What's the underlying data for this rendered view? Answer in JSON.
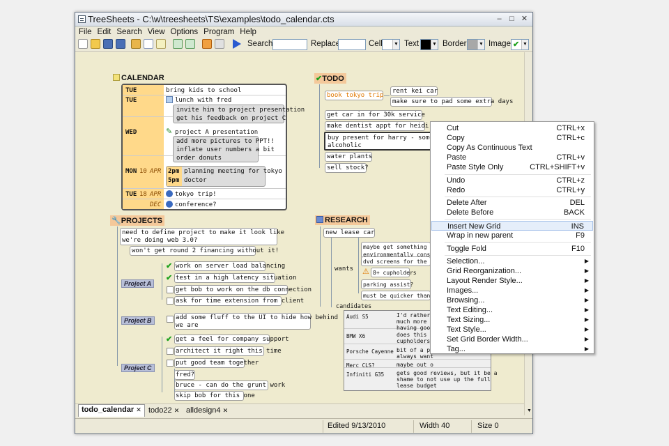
{
  "window": {
    "title": "TreeSheets - C:\\w\\treesheets\\TS\\examples\\todo_calendar.cts",
    "minimize": "–",
    "maximize": "□",
    "close": "✕"
  },
  "menubar": [
    "File",
    "Edit",
    "Search",
    "View",
    "Options",
    "Program",
    "Help"
  ],
  "toolbar": {
    "search_label": "Search",
    "replace_label": "Replace",
    "cell_label": "Cell",
    "text_label": "Text",
    "border_label": "Border",
    "image_label": "Image",
    "search_value": "",
    "replace_value": ""
  },
  "calendar": {
    "title": "CALENDAR",
    "rows": [
      {
        "day": "TUE",
        "text": "bring kids to school"
      },
      {
        "day": "TUE",
        "text": "lunch with fred",
        "sub": [
          "invite him to project presentation",
          "get his feedback on project C"
        ]
      },
      {
        "day": "WED",
        "text": "project A presentation",
        "sub": [
          "add more pictures to PPT!!",
          "inflate user numbers a bit",
          "order donuts"
        ]
      },
      {
        "day": "MON",
        "num": "10",
        "mon": "APR",
        "sub": [
          {
            "t": "2pm",
            "v": "planning meeting for tokyo"
          },
          {
            "t": "5pm",
            "v": "doctor"
          }
        ]
      },
      {
        "day": "TUE",
        "num": "18",
        "mon": "APR",
        "text": "tokyo trip!"
      },
      {
        "day": "",
        "num": "",
        "mon": "DEC",
        "text": "conference?"
      }
    ]
  },
  "todo": {
    "title": "TODO",
    "items": [
      "book tokyo trip",
      "rent kei car",
      "make sure to pad some extra days",
      "get car in for 30k service",
      "make dentist appt for heidi",
      "buy present for harry - somet",
      "alcoholic",
      "water plants",
      "sell stock?"
    ]
  },
  "projects": {
    "title": "PROJECTS",
    "intro": [
      "need to define project to make it look like",
      "we're doing web 3.0?",
      "won't get round 2 financing without it!"
    ],
    "a_label": "Project A",
    "a_items": [
      "work on server load balancing",
      "test in a high latency situation",
      "get bob to work on the db connection",
      "ask for time extension from client"
    ],
    "b_label": "Project B",
    "b_items": [
      "add some fluff to the UI to hide how behind",
      "we are"
    ],
    "c_label": "Project C",
    "c_items": [
      "get a feel for company support",
      "architect it right this time",
      "put good team together",
      "fred?",
      "bruce - can do the grunt work",
      "skip bob for this one"
    ]
  },
  "research": {
    "title": "RESEARCH",
    "lease": "new lease car",
    "wants_label": "wants",
    "wants": [
      "maybe get something th",
      "environmentally consc",
      "dvd screens for the ki",
      "8+ cupholders",
      "parking assist?",
      "must be quicker than t"
    ],
    "candidates_label": "candidates",
    "candidates": [
      {
        "car": "Audi S5",
        "note": [
          "I'd rather",
          "much more",
          "having good"
        ]
      },
      {
        "car": "BMW X6",
        "note": [
          "does this h",
          "cupholders?"
        ]
      },
      {
        "car": "Porsche Cayenne",
        "note": [
          "bit of a po",
          "always want"
        ]
      },
      {
        "car": "Merc CLS?",
        "note": [
          "maybe out o"
        ]
      },
      {
        "car": "Infiniti G35",
        "note": [
          "gets good reviews, but it be a",
          "shame to not use up the full",
          "lease budget"
        ]
      }
    ]
  },
  "tabs": [
    "todo_calendar",
    "todo22",
    "alldesign4"
  ],
  "status": {
    "edited": "Edited 9/13/2010",
    "width": "Width 40",
    "size": "Size 0"
  },
  "context_menu": [
    {
      "label": "Cut",
      "shortcut": "CTRL+x"
    },
    {
      "label": "Copy",
      "shortcut": "CTRL+c"
    },
    {
      "label": "Copy As Continuous Text",
      "shortcut": ""
    },
    {
      "label": "Paste",
      "shortcut": "CTRL+v"
    },
    {
      "label": "Paste Style Only",
      "shortcut": "CTRL+SHIFT+v"
    },
    {
      "label": "Undo",
      "shortcut": "CTRL+z"
    },
    {
      "label": "Redo",
      "shortcut": "CTRL+y"
    },
    {
      "label": "Delete After",
      "shortcut": "DEL"
    },
    {
      "label": "Delete Before",
      "shortcut": "BACK"
    },
    {
      "label": "Insert New Grid",
      "shortcut": "INS"
    },
    {
      "label": "Wrap in new parent",
      "shortcut": "F9"
    },
    {
      "label": "Toggle Fold",
      "shortcut": "F10"
    },
    {
      "label": "Selection...",
      "shortcut": ""
    },
    {
      "label": "Grid Reorganization...",
      "shortcut": ""
    },
    {
      "label": "Layout  Render Style...",
      "shortcut": ""
    },
    {
      "label": "Images...",
      "shortcut": ""
    },
    {
      "label": "Browsing...",
      "shortcut": ""
    },
    {
      "label": "Text Editing...",
      "shortcut": ""
    },
    {
      "label": "Text Sizing...",
      "shortcut": ""
    },
    {
      "label": "Text Style...",
      "shortcut": ""
    },
    {
      "label": "Set Grid Border Width...",
      "shortcut": ""
    },
    {
      "label": "Tag...",
      "shortcut": ""
    }
  ]
}
